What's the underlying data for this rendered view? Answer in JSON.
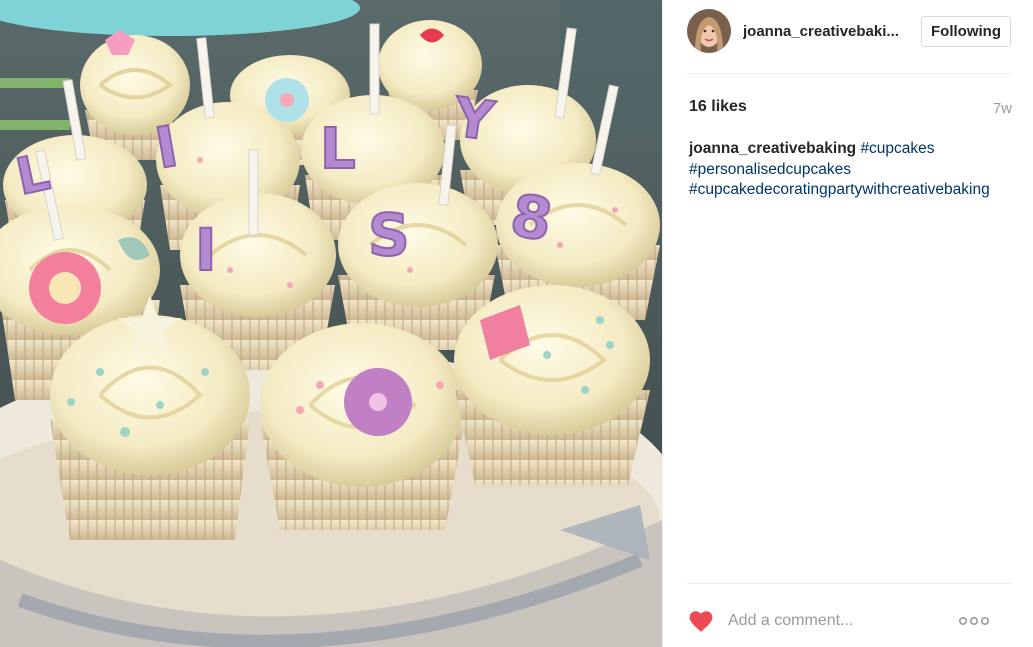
{
  "post": {
    "image": {
      "description_icon": "cupcakes-photo"
    },
    "author": {
      "username": "joanna_creativebaki...",
      "follow_label": "Following"
    },
    "likes": "16 likes",
    "age": "7w",
    "caption": {
      "username": "joanna_creativebaking",
      "tags": [
        "#cupcakes",
        "#personalisedcupcakes",
        "#cupcakedecoratingpartywithcreativebaking"
      ]
    },
    "comment_placeholder": "Add a comment...",
    "icons": {
      "like": "heart-icon",
      "more": "more-options-icon"
    },
    "colors": {
      "heart": "#ed4956",
      "hashtag": "#003569",
      "text": "#262626",
      "muted": "#999999"
    }
  }
}
